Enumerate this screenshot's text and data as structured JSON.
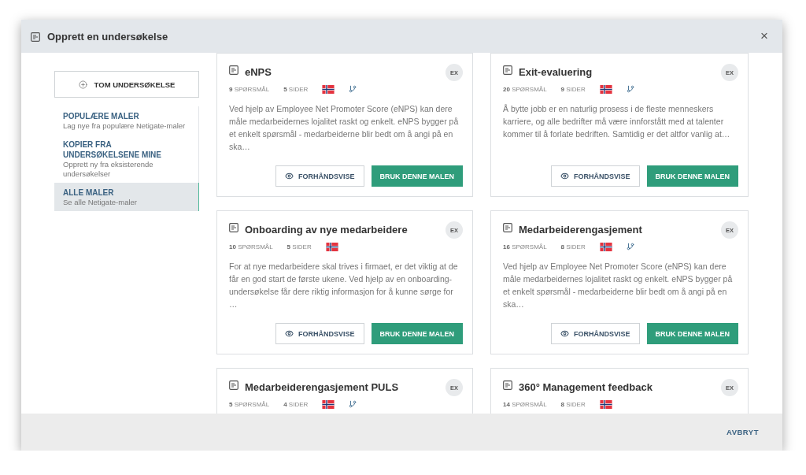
{
  "dialog": {
    "title": "Opprett en undersøkelse",
    "close": "×"
  },
  "sidebar": {
    "blank_button": "TOM UNDERSØKELSE",
    "items": [
      {
        "title": "POPULÆRE MALER",
        "subtitle": "Lag nye fra populære Netigate-maler",
        "selected": false
      },
      {
        "title": "KOPIER FRA UNDERSØKELSENE MINE",
        "subtitle": "Opprett ny fra eksisterende undersøkelser",
        "selected": false
      },
      {
        "title": "ALLE MALER",
        "subtitle": "Se alle Netigate-maler",
        "selected": true
      }
    ]
  },
  "templates": [
    {
      "title": "eNPS",
      "badge": "EX",
      "questions": "**9** SPØRSMÅL",
      "pages": "**5** SIDER",
      "branching": true,
      "description": "Ved hjelp av Employee Net Promoter Score (eNPS) kan dere måle medarbeidernes lojalitet raskt og enkelt. eNPS bygger på et enkelt spørsmål - medarbeiderne blir bedt om å angi på en ska…",
      "preview_button": "FORHÅNDSVISE",
      "use_button": "BRUK DENNE MALEN"
    },
    {
      "title": "Exit-evaluering",
      "badge": "EX",
      "questions": "**20** SPØRSMÅL",
      "pages": "**9** SIDER",
      "branching": true,
      "description": "Å bytte jobb er en naturlig prosess i de fleste menneskers karriere, og alle bedrifter må være innforstått med at talenter kommer til å forlate bedriften. Samtidig er det altfor vanlig at…",
      "preview_button": "FORHÅNDSVISE",
      "use_button": "BRUK DENNE MALEN"
    },
    {
      "title": "Onboarding av nye medarbeidere",
      "badge": "EX",
      "questions": "**10** SPØRSMÅL",
      "pages": "**5** SIDER",
      "branching": false,
      "description": "For at nye medarbeidere skal trives i firmaet, er det viktig at de får en god start de første ukene. Ved hjelp av en onboarding-undersøkelse får dere riktig informasjon for å kunne sørge for …",
      "preview_button": "FORHÅNDSVISE",
      "use_button": "BRUK DENNE MALEN"
    },
    {
      "title": "Medarbeiderengasjement",
      "badge": "EX",
      "questions": "**16** SPØRSMÅL",
      "pages": "**8** SIDER",
      "branching": true,
      "description": "Ved hjelp av Employee Net Promoter Score (eNPS) kan dere måle medarbeidernes lojalitet raskt og enkelt. eNPS bygger på et enkelt spørsmål - medarbeiderne blir bedt om å angi på en ska…",
      "preview_button": "FORHÅNDSVISE",
      "use_button": "BRUK DENNE MALEN"
    },
    {
      "title": "Medarbeiderengasjement PULS",
      "badge": "EX",
      "questions": "**5** SPØRSMÅL",
      "pages": "**4** SIDER",
      "branching": true
    },
    {
      "title": "360° Management feedback",
      "badge": "EX",
      "questions": "**14** SPØRSMÅL",
      "pages": "**8** SIDER",
      "branching": false
    }
  ],
  "footer": {
    "cancel_button": "AVBRYT"
  }
}
